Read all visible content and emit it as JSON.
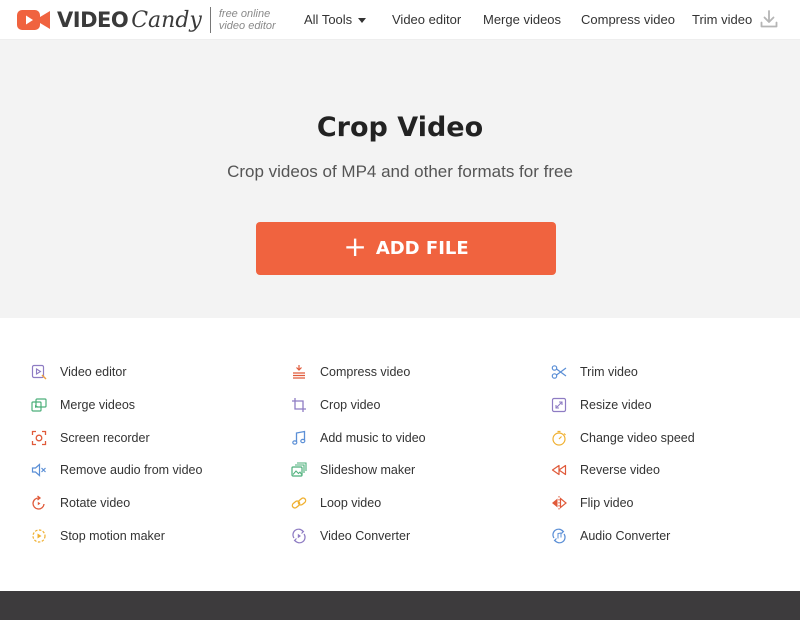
{
  "header": {
    "logo_video": "VIDEO",
    "logo_candy": "Candy",
    "tagline_line1": "free online",
    "tagline_line2": "video editor",
    "nav": {
      "all_tools": "All Tools",
      "video_editor": "Video editor",
      "merge_videos": "Merge videos",
      "compress_video": "Compress video",
      "trim_video": "Trim video"
    },
    "icons": {
      "logo": "video-camera-logo-icon",
      "download": "download-icon"
    }
  },
  "hero": {
    "title": "Crop Video",
    "subtitle": "Crop videos of MP4 and other formats for free",
    "button_icon": "plus-icon",
    "button_label": "ADD FILE"
  },
  "tools": {
    "col1": [
      {
        "label": "Video editor",
        "icon": "video-editor-icon"
      },
      {
        "label": "Merge videos",
        "icon": "merge-videos-icon"
      },
      {
        "label": "Screen recorder",
        "icon": "screen-recorder-icon"
      },
      {
        "label": "Remove audio from video",
        "icon": "mute-icon"
      },
      {
        "label": "Rotate video",
        "icon": "rotate-icon"
      },
      {
        "label": "Stop motion maker",
        "icon": "stop-motion-icon"
      }
    ],
    "col2": [
      {
        "label": "Compress video",
        "icon": "compress-icon"
      },
      {
        "label": "Crop video",
        "icon": "crop-icon"
      },
      {
        "label": "Add music to video",
        "icon": "music-note-icon"
      },
      {
        "label": "Slideshow maker",
        "icon": "slideshow-icon"
      },
      {
        "label": "Loop video",
        "icon": "loop-link-icon"
      },
      {
        "label": "Video Converter",
        "icon": "convert-icon"
      }
    ],
    "col3": [
      {
        "label": "Trim video",
        "icon": "scissors-icon"
      },
      {
        "label": "Resize video",
        "icon": "resize-icon"
      },
      {
        "label": "Change video speed",
        "icon": "speed-clock-icon"
      },
      {
        "label": "Reverse video",
        "icon": "reverse-icon"
      },
      {
        "label": "Flip video",
        "icon": "flip-icon"
      },
      {
        "label": "Audio Converter",
        "icon": "audio-convert-icon"
      }
    ]
  },
  "colors": {
    "accent": "#f0633f",
    "hero_bg": "#f3f3f3",
    "footer_bg": "#3d3b3d"
  }
}
